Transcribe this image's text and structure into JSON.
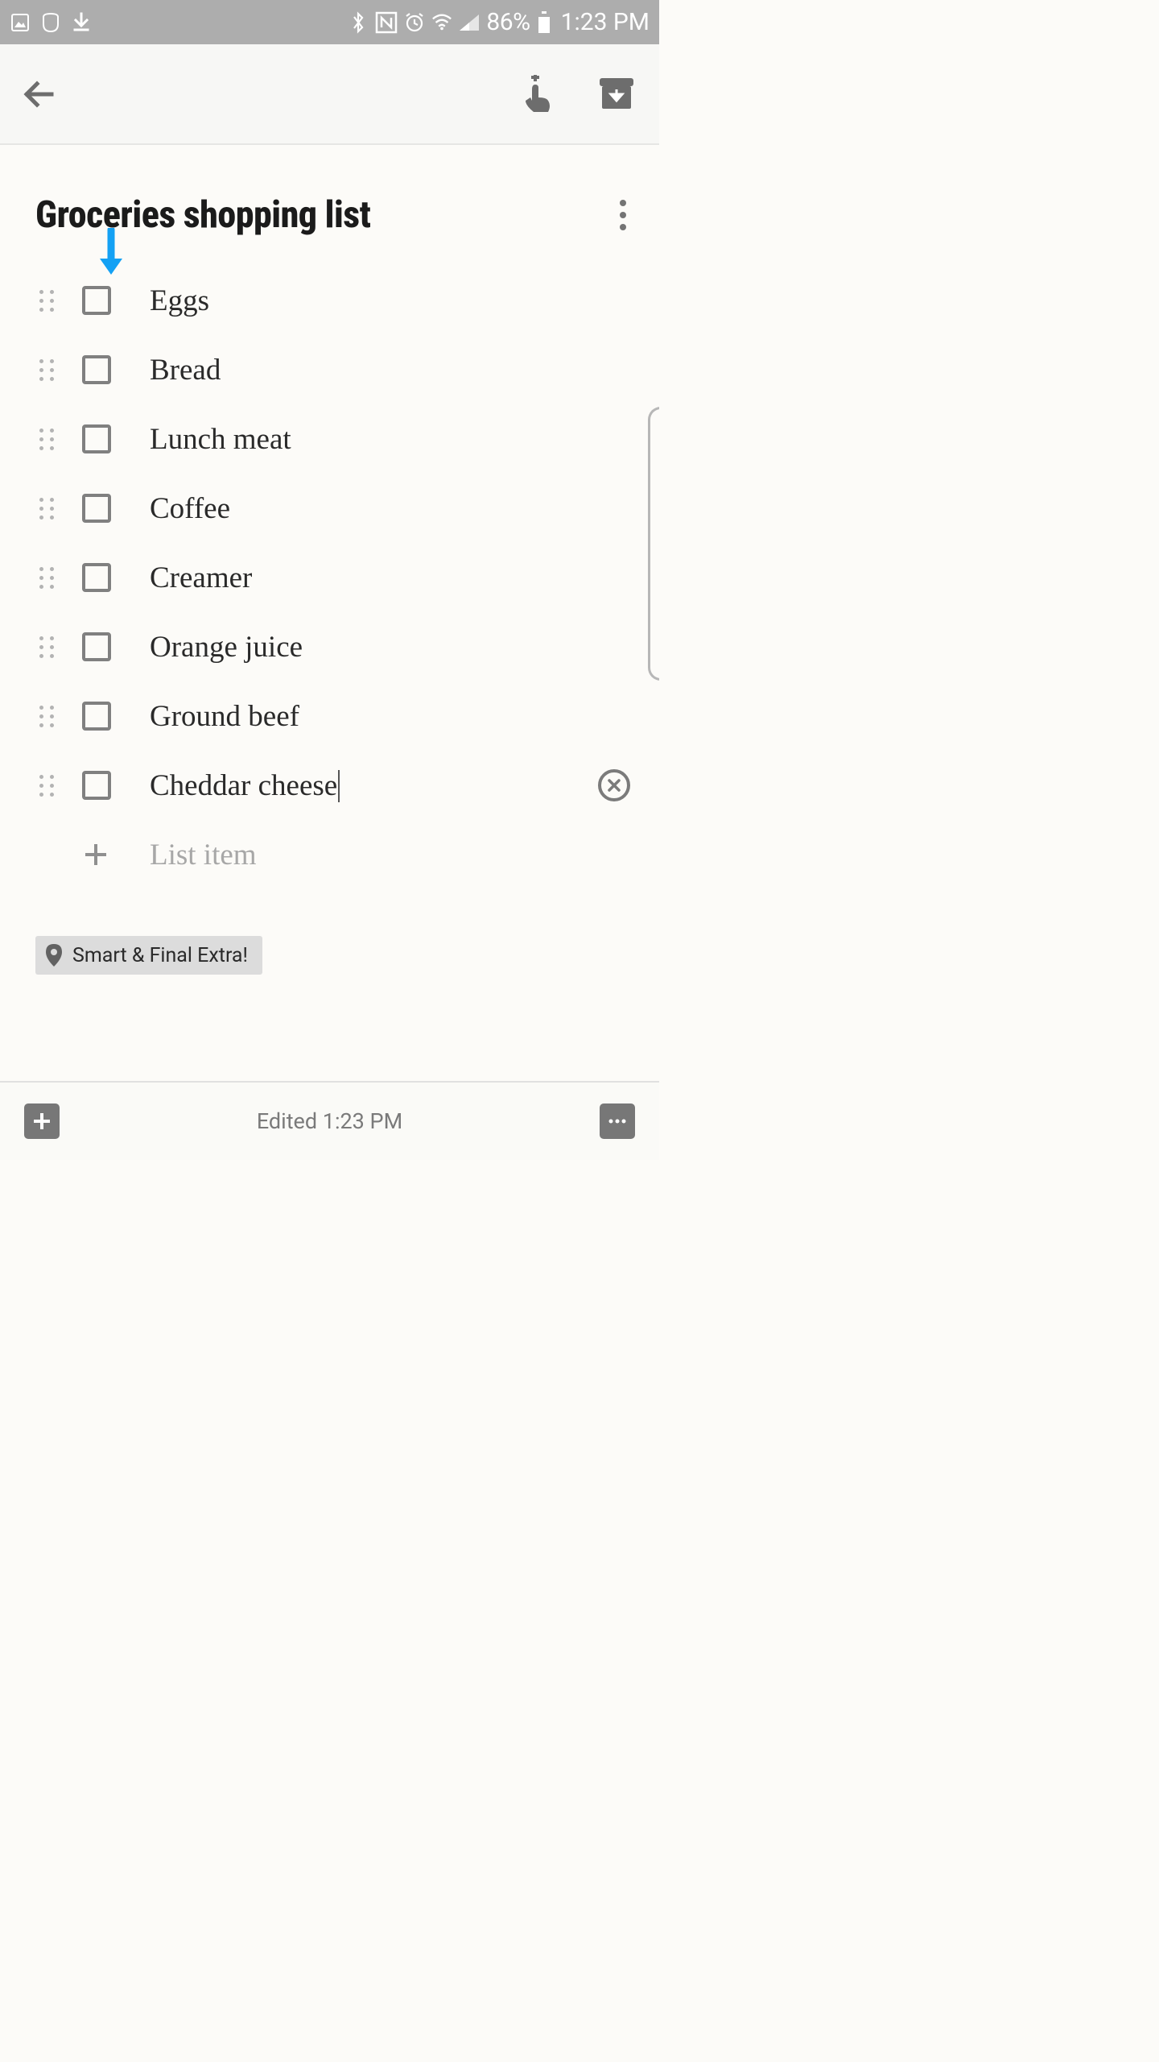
{
  "status": {
    "battery_pct": "86%",
    "clock": "1:23 PM"
  },
  "note": {
    "title": "Groceries shopping list",
    "items": [
      {
        "label": "Eggs"
      },
      {
        "label": "Bread"
      },
      {
        "label": "Lunch meat"
      },
      {
        "label": "Coffee"
      },
      {
        "label": "Creamer"
      },
      {
        "label": "Orange juice"
      },
      {
        "label": "Ground beef"
      },
      {
        "label": "Cheddar cheese"
      }
    ],
    "add_placeholder": "List item",
    "location_label": "Smart & Final Extra!"
  },
  "footer": {
    "edited_label": "Edited 1:23 PM"
  },
  "colors": {
    "accent_arrow": "#14a1f4"
  }
}
